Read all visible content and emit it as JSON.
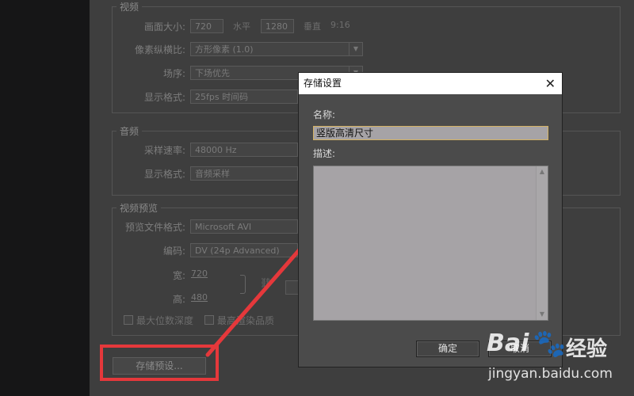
{
  "video": {
    "title": "视频",
    "frame_size_label": "画面大小:",
    "width_value": "720",
    "horizontal_label": "水平",
    "height_value": "1280",
    "vertical_label": "垂直",
    "ratio": "9:16",
    "pixel_aspect_label": "像素纵横比:",
    "pixel_aspect_value": "方形像素 (1.0)",
    "field_order_label": "场序:",
    "field_order_value": "下场优先",
    "display_format_label": "显示格式:",
    "display_format_value": "25fps 时间码"
  },
  "audio": {
    "title": "音频",
    "sample_rate_label": "采样速率:",
    "sample_rate_value": "48000 Hz",
    "display_format_label": "显示格式:",
    "display_format_value": "音频采样"
  },
  "preview": {
    "title": "视频预览",
    "file_format_label": "预览文件格式:",
    "file_format_value": "Microsoft AVI",
    "codec_label": "编码:",
    "codec_value": "DV (24p Advanced)",
    "width_label": "宽:",
    "width_value": "720",
    "height_label": "高:",
    "height_value": "480",
    "max_bit_depth": "最大位数深度",
    "max_render_quality": "最高渲染品质"
  },
  "save_preset_button": "存储预设...",
  "dialog": {
    "title": "存储设置",
    "close_glyph": "✕",
    "name_label": "名称:",
    "name_value": "竖版高清尺寸",
    "description_label": "描述:",
    "ok_label": "确定",
    "cancel_label": "取消"
  },
  "watermark": {
    "brand": "Bai",
    "brand_suffix": "经验",
    "url": "jingyan.baidu.com"
  },
  "colors": {
    "highlight": "#e5383b",
    "dialog_bg": "#4b4b4b",
    "panel_bg": "#3e3e3e"
  }
}
